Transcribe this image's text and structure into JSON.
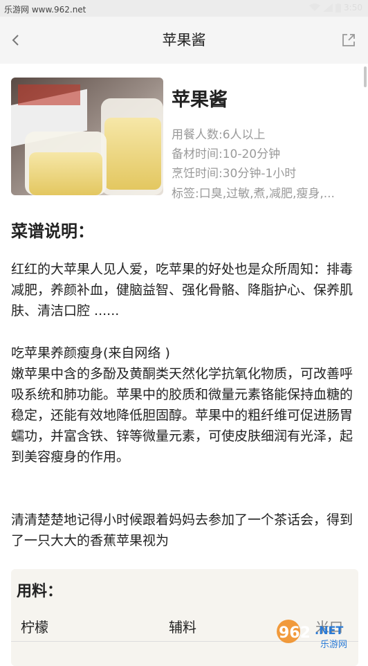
{
  "status_bar": {
    "site": "乐游网 www.962.net",
    "time": "3:50"
  },
  "header": {
    "title": "苹果酱"
  },
  "recipe": {
    "title": "苹果酱",
    "servings": "用餐人数:6人以上",
    "prep_time": "备材时间:10-20分钟",
    "cook_time": "烹饪时间:30分钟-1小时",
    "tags": "标签:口臭,过敏,煮,减肥,瘦身,..."
  },
  "description": {
    "title": "菜谱说明：",
    "para1": "红红的大苹果人见人爱，吃苹果的好处也是众所周知：排毒减肥，养颜补血，健脑益智、强化骨骼、降脂护心、保养肌肤、清洁口腔 ......",
    "para2_heading": "吃苹果养颜瘦身(来自网络 )",
    "para2": "嫩苹果中含的多酚及黄酮类天然化学抗氧化物质，可改善呼吸系统和肺功能。苹果中的胶质和微量元素铬能保持血糖的稳定，还能有效地降低胆固醇。苹果中的粗纤维可促进肠胃蠕功，并富含铁、锌等微量元素，可使皮肤细润有光泽，起到美容瘦身的作用。",
    "para3": "清清楚楚地记得小时候跟着妈妈去参加了一个茶话会，得到了一只大大的香蕉苹果视为"
  },
  "ingredients": {
    "title": "用料：",
    "row1": [
      "柠檬",
      "辅料",
      "米口"
    ]
  },
  "watermark": {
    "brand": "962",
    "suffix": ".NET",
    "sub": "乐游网"
  },
  "colors": {
    "header_bg": "#f5f5f5",
    "meta_text": "#9a9a9a",
    "ingredients_bg": "#f6f4ef"
  }
}
